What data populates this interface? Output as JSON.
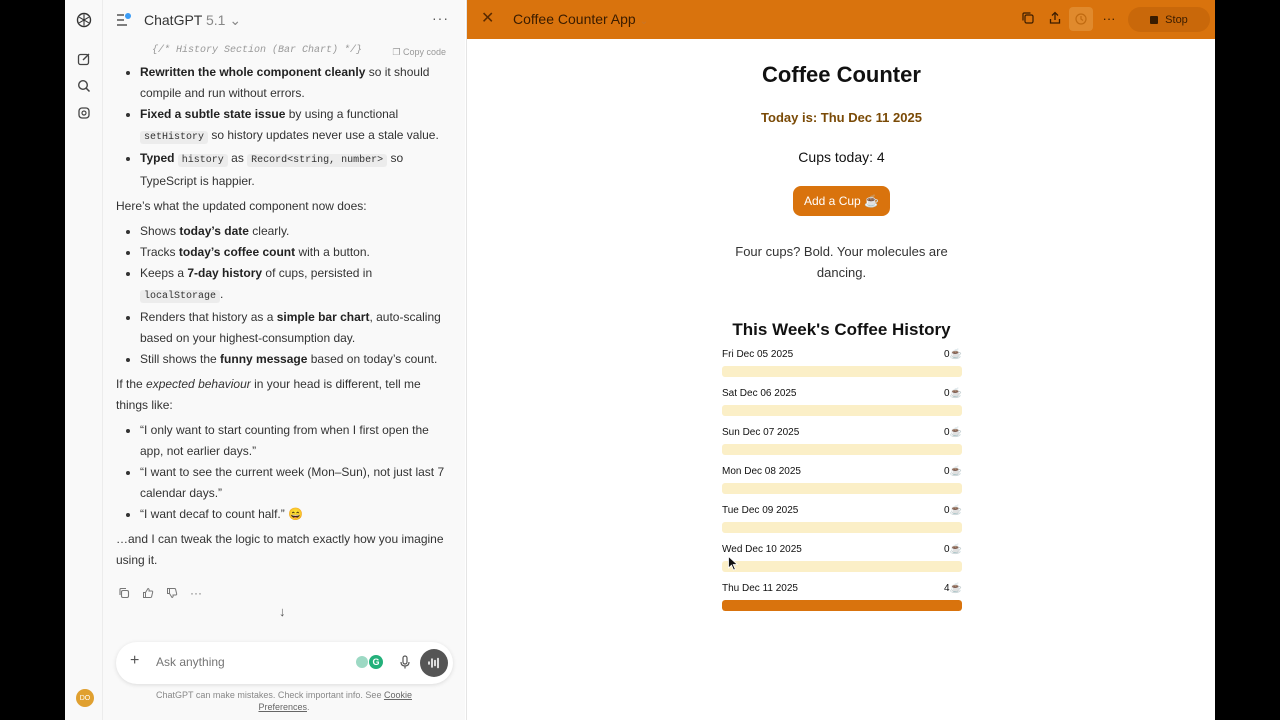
{
  "chat": {
    "model": "ChatGPT",
    "version": "5.1",
    "code_tail": "{/* History Section (Bar Chart) */}",
    "copy_label": "Copy code",
    "bullets_a": [
      {
        "bold": "Rewritten the whole component cleanly",
        "text": " so it should compile and run without errors."
      },
      {
        "bold": "Fixed a subtle state issue",
        "text": " by using a functional ",
        "code": "setHistory",
        "text2": " so history updates never use a stale value."
      },
      {
        "bold": "Typed",
        "text": " ",
        "code": "history",
        "text2": " as ",
        "code2": "Record<string, number>",
        "text3": " so TypeScript is happier."
      }
    ],
    "intro": "Here’s what the updated component now does:",
    "bullets_b": [
      {
        "pre": "Shows ",
        "bold": "today’s date",
        "post": " clearly."
      },
      {
        "pre": "Tracks ",
        "bold": "today’s coffee count",
        "post": " with a button."
      },
      {
        "pre": "Keeps a ",
        "bold": "7-day history",
        "post": " of cups, persisted in ",
        "code": "localStorage",
        "post2": "."
      },
      {
        "pre": "Renders that history as a ",
        "bold": "simple bar chart",
        "post": ", auto-scaling based on your highest-consumption day."
      },
      {
        "pre": "Still shows the ",
        "bold": "funny message",
        "post": " based on today’s count."
      }
    ],
    "para2_pre": "If the ",
    "para2_em": "expected behaviour",
    "para2_post": " in your head is different, tell me things like:",
    "quotes": [
      "“I only want to start counting from when I first open the app, not earlier days.”",
      "“I want to see the current week (Mon–Sun), not just last 7 calendar days.”",
      "“I want decaf to count half.” 😄"
    ],
    "closing": "…and I can tweak the logic to match exactly how you imagine using it.",
    "composer_placeholder": "Ask anything",
    "disclaimer": "ChatGPT can make mistakes. Check important info. See",
    "disclaimer_link": "Cookie Preferences",
    "avatar_initials": "DO"
  },
  "canvas": {
    "title": "Coffee Counter App",
    "stop_label": "Stop",
    "accent": "#d9730d"
  },
  "app": {
    "heading": "Coffee Counter",
    "today": "Today is: Thu Dec 11 2025",
    "cups": "Cups today: 4",
    "add_button": "Add a Cup ☕",
    "message": "Four cups? Bold. Your molecules are dancing.",
    "history_heading": "This Week's Coffee History",
    "cup_icon": "☕"
  },
  "chart_data": {
    "type": "bar",
    "orientation": "horizontal",
    "title": "This Week's Coffee History",
    "categories": [
      "Fri Dec 05 2025",
      "Sat Dec 06 2025",
      "Sun Dec 07 2025",
      "Mon Dec 08 2025",
      "Tue Dec 09 2025",
      "Wed Dec 10 2025",
      "Thu Dec 11 2025"
    ],
    "values": [
      0,
      0,
      0,
      0,
      0,
      0,
      4
    ],
    "ylim": [
      0,
      4
    ],
    "grid": false
  }
}
